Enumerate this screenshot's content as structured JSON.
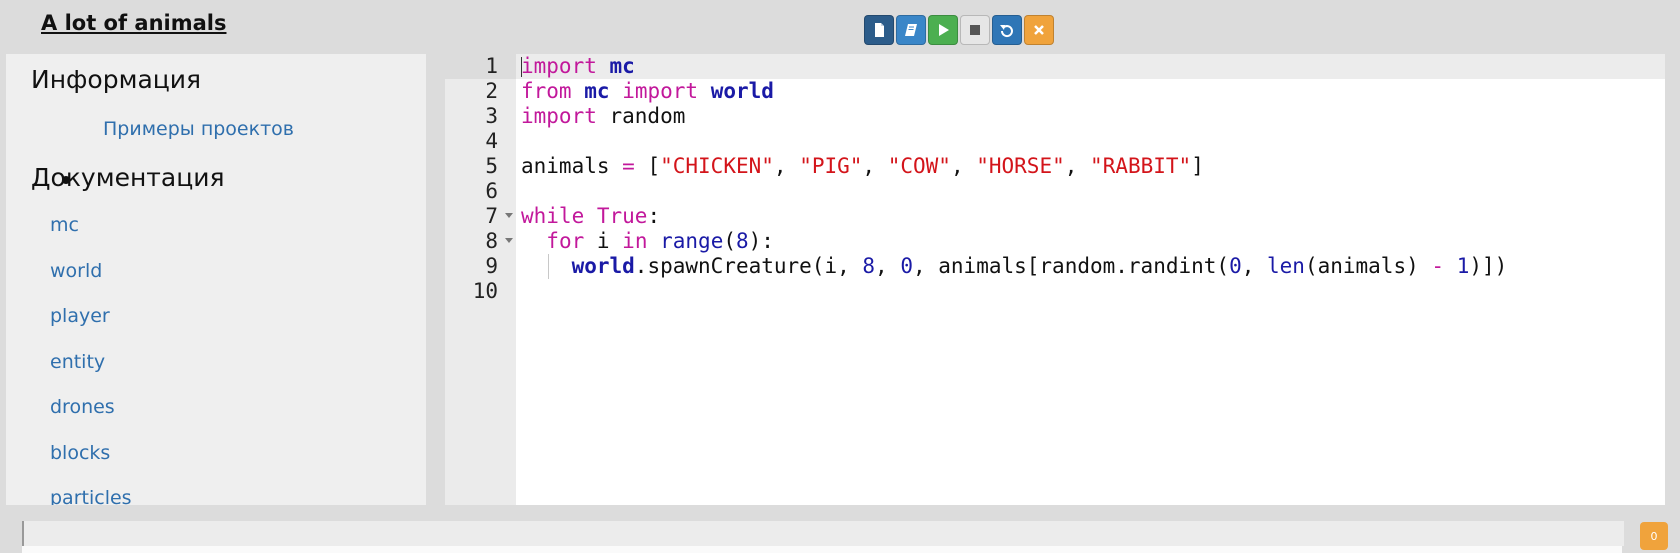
{
  "page": {
    "title": "A lot of animals"
  },
  "toolbar": {
    "buttons": [
      {
        "name": "new-file",
        "icon": "file-icon",
        "color": "#2c5c8a"
      },
      {
        "name": "docs",
        "icon": "book-icon",
        "color": "#3a86c8"
      },
      {
        "name": "run",
        "icon": "play-icon",
        "color": "#4caf50"
      },
      {
        "name": "stop",
        "icon": "stop-icon",
        "color": "#e6e6e6"
      },
      {
        "name": "reset",
        "icon": "undo-icon",
        "color": "#2f76b6"
      },
      {
        "name": "close",
        "icon": "close-icon",
        "color": "#f0a33c"
      }
    ]
  },
  "sidebar": {
    "info_heading": "Информация",
    "info_links": [
      "Примеры проектов"
    ],
    "docs_heading": "Документация",
    "doc_links": [
      "mc",
      "world",
      "player",
      "entity",
      "drones",
      "blocks",
      "particles"
    ]
  },
  "editor": {
    "line_numbers": [
      "1",
      "2",
      "3",
      "4",
      "5",
      "6",
      "7",
      "8",
      "9",
      "10"
    ],
    "lines": [
      "import mc",
      "from mc import world",
      "import random",
      "",
      "animals = [\"CHICKEN\", \"PIG\", \"COW\", \"HORSE\", \"RABBIT\"]",
      "",
      "while True:",
      "  for i in range(8):",
      "    world.spawnCreature(i, 8, 0, animals[random.randint(0, len(animals) - 1)])",
      ""
    ]
  },
  "console": {
    "badge": "0"
  }
}
